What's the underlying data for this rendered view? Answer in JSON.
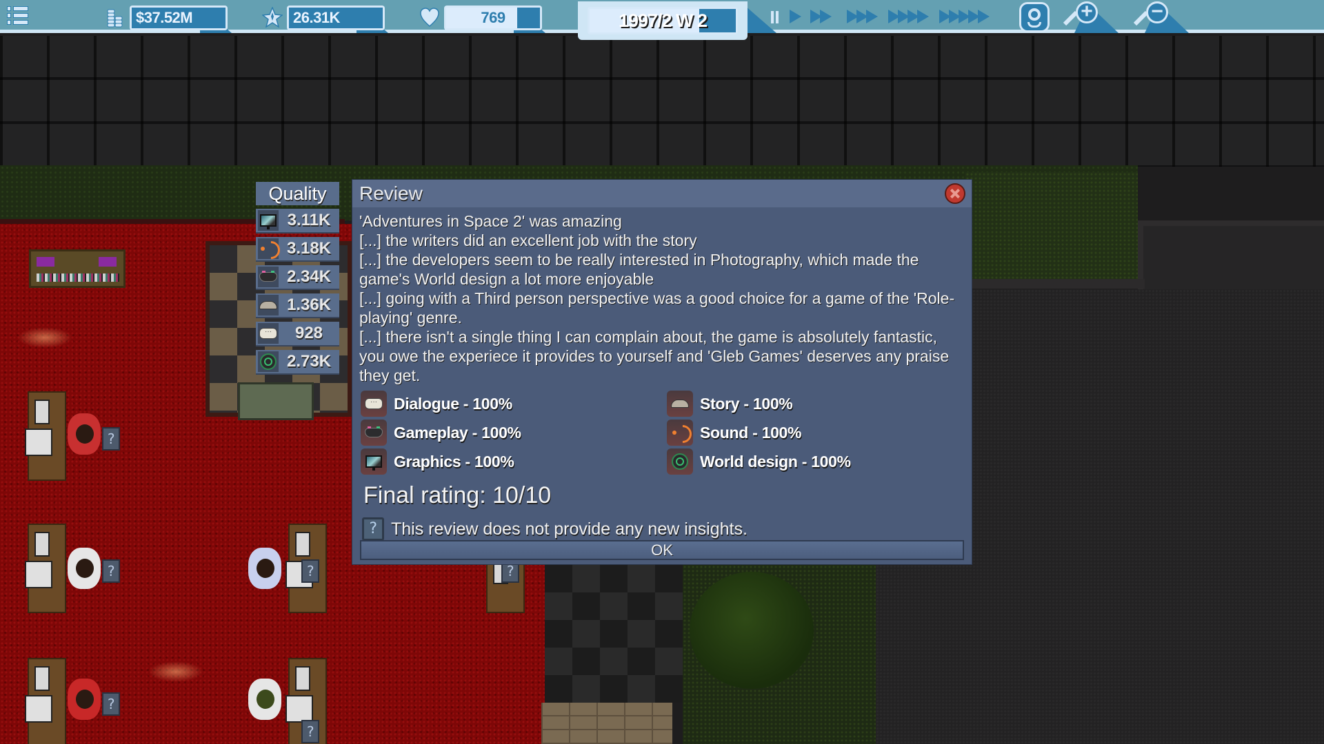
{
  "topbar": {
    "menu_icon": "menu-list-icon",
    "money": {
      "icon": "coins-icon",
      "value": "$37.52M"
    },
    "fans": {
      "icon": "star-icon",
      "value": "26.31K"
    },
    "hype": {
      "icon": "heart-icon",
      "value": "769",
      "fill_percent": 76
    },
    "date": {
      "value": "1997/2 W 2",
      "week_progress_percent": 75
    },
    "speed_controls": [
      {
        "name": "pause",
        "icon": "pause-icon"
      },
      {
        "name": "speed-1",
        "arrows": 1
      },
      {
        "name": "speed-2",
        "arrows": 2
      },
      {
        "name": "speed-3",
        "arrows": 3
      },
      {
        "name": "speed-4",
        "arrows": 4
      },
      {
        "name": "speed-5",
        "arrows": 5
      }
    ],
    "camera_icon": "webcam-icon",
    "zoom_in_icon": "zoom-in-icon",
    "zoom_out_icon": "zoom-out-icon",
    "zoom_in_symbol": "+",
    "zoom_out_symbol": "−"
  },
  "quality": {
    "title": "Quality",
    "rows": [
      {
        "icon": "graphics-icon",
        "value": "3.11K"
      },
      {
        "icon": "sound-icon",
        "value": "3.18K"
      },
      {
        "icon": "gameplay-icon",
        "value": "2.34K"
      },
      {
        "icon": "story-icon",
        "value": "1.36K"
      },
      {
        "icon": "dialogue-icon",
        "value": "928"
      },
      {
        "icon": "world-design-icon",
        "value": "2.73K"
      }
    ]
  },
  "review": {
    "title": "Review",
    "lines": [
      "'Adventures in Space 2' was amazing",
      "[...] the writers did an excellent job with the story",
      "[...] the developers seem to be really interested in Photography, which made the game's World design a lot more enjoyable",
      "[...] going with a Third person perspective was a good choice for a game of the 'Role-playing' genre.",
      "[...] there isn't a single thing I can complain about, the game is absolutely fantastic, you owe the experiece it provides to yourself and 'Gleb Games' deserves any praise they get."
    ],
    "scores": [
      {
        "icon": "dialogue-icon",
        "label": "Dialogue - 100%"
      },
      {
        "icon": "story-icon",
        "label": "Story - 100%"
      },
      {
        "icon": "gameplay-icon",
        "label": "Gameplay - 100%"
      },
      {
        "icon": "sound-icon",
        "label": "Sound - 100%"
      },
      {
        "icon": "graphics-icon",
        "label": "Graphics - 100%"
      },
      {
        "icon": "world-design-icon",
        "label": "World design - 100%"
      }
    ],
    "final_rating": "Final rating: 10/10",
    "insight_icon": "?",
    "insight": "This review does not provide any new insights.",
    "ok_label": "OK"
  },
  "colors": {
    "topbar_bg": "#64a0b2",
    "topbar_accent": "#2e7eae",
    "dialog_bg": "#4b5b79",
    "dialog_header": "#5a6b8b",
    "close_button": "#c0392f"
  }
}
